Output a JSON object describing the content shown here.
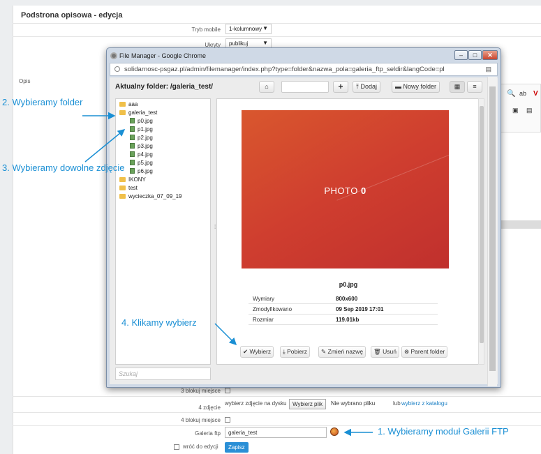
{
  "page": {
    "title": "Podstrona opisowa - edycja",
    "fields": {
      "tryb_mobile": {
        "label": "Tryb mobile",
        "value": "1-kolumnowy"
      },
      "ukryty": {
        "label": "Ukryty",
        "value": "publikuj"
      },
      "opis": {
        "label": "Opis"
      },
      "blokuj3": {
        "label": "3 blokuj miejsce"
      },
      "zdjecie4": {
        "label": "4 zdjęcie",
        "text": "wybierz zdjęcie na dysku",
        "file_button": "Wybierz plik",
        "file_status": "Nie wybrano pliku",
        "or": "lub",
        "catalog_link": "wybierz z katalogu"
      },
      "blokuj4": {
        "label": "4 blokuj miejsce"
      },
      "galeria": {
        "label": "Galeria ftp",
        "value": "galeria_test"
      },
      "wroc": {
        "label": "wróć do edycji"
      }
    },
    "save_button": "Zapisz"
  },
  "popup": {
    "window_title": "File Manager - Google Chrome",
    "url": "solidarnosc-psgaz.pl/admin/filemanager/index.php?type=folder&nazwa_pola=galeria_ftp_seldir&langCode=pl",
    "current_folder_label": "Aktualny folder:",
    "current_folder": "/galeria_test/",
    "toolbar": {
      "add": "Dodaj",
      "new_folder": "Nowy folder"
    },
    "tree": [
      {
        "name": "aaa",
        "type": "folder"
      },
      {
        "name": "galeria_test",
        "type": "folder"
      },
      {
        "name": "p0.jpg",
        "type": "image"
      },
      {
        "name": "p1.jpg",
        "type": "image"
      },
      {
        "name": "p2.jpg",
        "type": "image"
      },
      {
        "name": "p3.jpg",
        "type": "image"
      },
      {
        "name": "p4.jpg",
        "type": "image"
      },
      {
        "name": "p5.jpg",
        "type": "image"
      },
      {
        "name": "p6.jpg",
        "type": "image"
      },
      {
        "name": "IKONY",
        "type": "folder"
      },
      {
        "name": "test",
        "type": "folder"
      },
      {
        "name": "wycieczka_07_09_19",
        "type": "folder"
      }
    ],
    "preview": {
      "photo_text": "PHOTO",
      "photo_number": "0",
      "filename": "p0.jpg",
      "info": [
        {
          "key": "Wymiary",
          "value": "800x600"
        },
        {
          "key": "Zmodyfikowano",
          "value": "09 Sep 2019 17:01"
        },
        {
          "key": "Rozmiar",
          "value": "119.01kb"
        }
      ]
    },
    "actions": {
      "select": "Wybierz",
      "download": "Pobierz",
      "rename": "Zmień nazwę",
      "delete": "Usuń",
      "parent": "Parent folder"
    },
    "search_placeholder": "Szukaj"
  },
  "annotations": {
    "a1": "1. Wybieramy moduł Galerii FTP",
    "a2": "2. Wybieramy folder",
    "a3": "3. Wybieramy dowolne zdjęcie",
    "a4": "4. Klikamy wybierz"
  },
  "colors": {
    "annotation": "#1a8fd4",
    "photo": "#cf3e2f",
    "save": "#2a8fd6"
  }
}
